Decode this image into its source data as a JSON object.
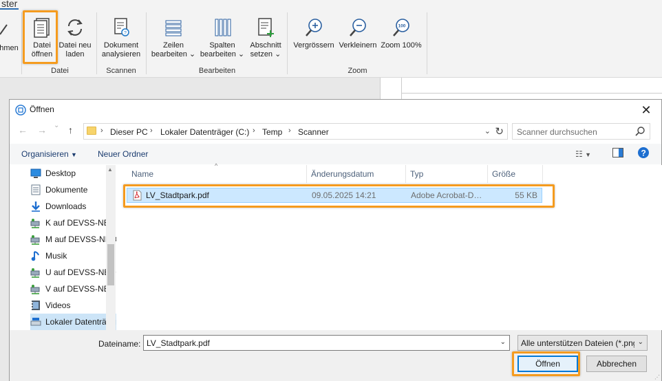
{
  "ribbon": {
    "tab_partial": "ster",
    "left_partial_label": "hmen",
    "buttons": {
      "open_file": {
        "line1": "Datei",
        "line2": "öffnen"
      },
      "reload_file": {
        "line1": "Datei neu",
        "line2": "laden"
      },
      "analyze": {
        "line1": "Dokument",
        "line2": "analysieren"
      },
      "edit_rows": {
        "line1": "Zeilen",
        "line2": "bearbeiten"
      },
      "edit_columns": {
        "line1": "Spalten",
        "line2": "bearbeiten"
      },
      "set_section": {
        "line1": "Abschnitt",
        "line2": "setzen"
      },
      "zoom_in": {
        "line1": "Vergrössern"
      },
      "zoom_out": {
        "line1": "Verkleinern"
      },
      "zoom_100": {
        "line1": "Zoom 100%"
      }
    },
    "groups": {
      "file": "Datei",
      "scan": "Scannen",
      "edit": "Bearbeiten",
      "zoom": "Zoom"
    }
  },
  "dialog": {
    "title": "Öffnen",
    "breadcrumb": [
      "Dieser PC",
      "Lokaler Datenträger (C:)",
      "Temp",
      "Scanner"
    ],
    "search_placeholder": "Scanner durchsuchen",
    "toolbar": {
      "organize": "Organisieren",
      "new_folder": "Neuer Ordner"
    },
    "nav_items": [
      {
        "label": "Desktop",
        "icon": "desktop-icon"
      },
      {
        "label": "Dokumente",
        "icon": "documents-icon"
      },
      {
        "label": "Downloads",
        "icon": "download-icon"
      },
      {
        "label": "K auf DEVSS-NBO",
        "icon": "network-drive-icon"
      },
      {
        "label": "M auf DEVSS-NBO",
        "icon": "network-drive-icon"
      },
      {
        "label": "Musik",
        "icon": "music-icon"
      },
      {
        "label": "U auf DEVSS-NBO",
        "icon": "network-drive-icon"
      },
      {
        "label": "V auf DEVSS-NBO",
        "icon": "network-drive-icon"
      },
      {
        "label": "Videos",
        "icon": "video-icon"
      },
      {
        "label": "Lokaler Datenträger (C:)",
        "icon": "local-drive-icon"
      }
    ],
    "columns": {
      "name": "Name",
      "modified": "Änderungsdatum",
      "type": "Typ",
      "size": "Größe"
    },
    "files": [
      {
        "name": "LV_Stadtpark.pdf",
        "modified": "09.05.2025 14:21",
        "type": "Adobe Acrobat-Dokument",
        "size": "55 KB"
      }
    ],
    "filename_label": "Dateiname:",
    "filename_value": "LV_Stadtpark.pdf",
    "filetype_value": "Alle unterstützen Dateien (*.png",
    "open_button": "Öffnen",
    "cancel_button": "Abbrechen"
  },
  "colors": {
    "highlight": "#f59b1e",
    "accent": "#0078d7",
    "selection": "#cce8ff"
  }
}
